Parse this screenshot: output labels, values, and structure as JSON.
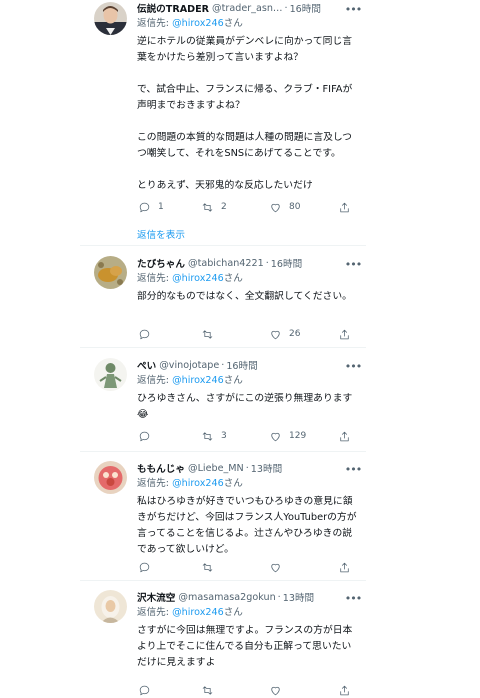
{
  "thread": {
    "show_replies_label": "返信を表示",
    "reply_prefix": "返信先: ",
    "reply_suffix": "さん"
  },
  "tweets": [
    {
      "name": "伝説のTRADER",
      "handle": "@trader_asn…",
      "time": "16時間",
      "reply_to": "@hirox246",
      "text": "逆にホテルの従業員がデンベレに向かって同じ言葉をかけたら差別って言いますよね？\n\nで、試合中止、フランスに帰る、クラブ・FIFAが声明までおきますよね？\n\nこの問題の本質的な問題は人種の問題に言及しつつ嘲笑して、それをSNSにあげてることです。\n\nとりあえず、天邪鬼的な反応したいだけ",
      "replies": "1",
      "retweets": "2",
      "likes": "80"
    },
    {
      "name": "たびちゃん",
      "handle": "@tabichan4221",
      "time": "16時間",
      "reply_to": "@hirox246",
      "text": "部分的なものではなく、全文翻訳してください。",
      "replies": "",
      "retweets": "",
      "likes": "26"
    },
    {
      "name": "ぺい",
      "handle": "@vinojotape",
      "time": "16時間",
      "reply_to": "@hirox246",
      "text": "ひろゆきさん、さすがにこの逆張り無理あります😂",
      "replies": "",
      "retweets": "3",
      "likes": "129"
    },
    {
      "name": "ももんじゃ",
      "handle": "@Liebe_MN",
      "time": "13時間",
      "reply_to": "@hirox246",
      "text": "私はひろゆきが好きでいつもひろゆきの意見に頷きがちだけど、今回はフランス人YouTuberの方が言ってることを信じるよ。辻さんやひろゆきの説であって欲しいけど。",
      "replies": "",
      "retweets": "",
      "likes": ""
    },
    {
      "name": "沢木流空",
      "handle": "@masamasa2gokun",
      "time": "13時間",
      "reply_to": "@hirox246",
      "text": "さすがに今回は無理ですよ。フランスの方が日本より上でそこに住んでる自分も正解って思いたいだけに見えますよ",
      "replies": "",
      "retweets": "",
      "likes": ""
    }
  ]
}
